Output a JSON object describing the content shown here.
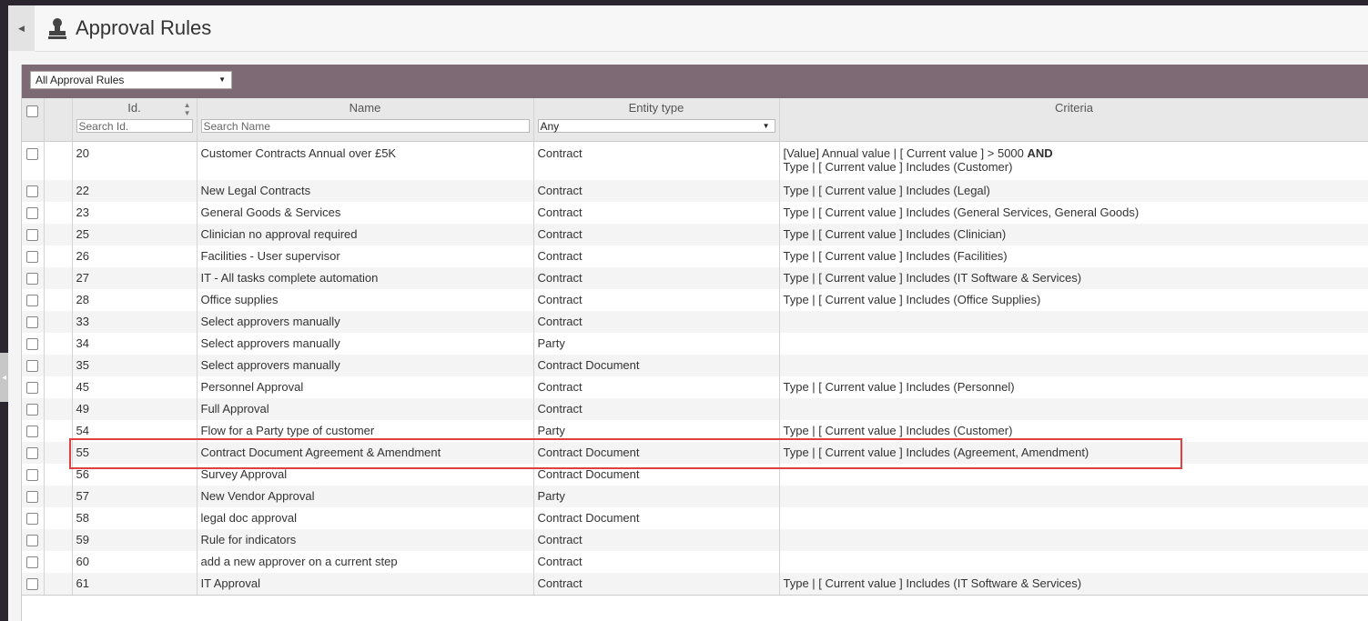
{
  "header": {
    "title": "Approval Rules"
  },
  "toolbar": {
    "filter_selected": "All Approval Rules"
  },
  "table": {
    "columns": {
      "id": "Id.",
      "name": "Name",
      "entity": "Entity type",
      "criteria": "Criteria"
    },
    "filters": {
      "id_placeholder": "Search Id.",
      "name_placeholder": "Search Name",
      "entity_selected": "Any"
    },
    "rows": [
      {
        "id": "20",
        "name": "Customer Contracts Annual over £5K",
        "entity": "Contract",
        "criteria_line1": "[Value] Annual value | [ Current value ] > 5000",
        "criteria_and": "AND",
        "criteria_line2": "Type | [ Current value ] Includes (Customer)"
      },
      {
        "id": "22",
        "name": "New Legal Contracts",
        "entity": "Contract",
        "criteria": "Type | [ Current value ] Includes (Legal)"
      },
      {
        "id": "23",
        "name": "General Goods & Services",
        "entity": "Contract",
        "criteria": "Type | [ Current value ] Includes (General Services, General Goods)"
      },
      {
        "id": "25",
        "name": "Clinician no approval required",
        "entity": "Contract",
        "criteria": "Type | [ Current value ] Includes (Clinician)"
      },
      {
        "id": "26",
        "name": "Facilities - User supervisor",
        "entity": "Contract",
        "criteria": "Type | [ Current value ] Includes (Facilities)"
      },
      {
        "id": "27",
        "name": "IT - All tasks complete automation",
        "entity": "Contract",
        "criteria": "Type | [ Current value ] Includes (IT Software & Services)"
      },
      {
        "id": "28",
        "name": "Office supplies",
        "entity": "Contract",
        "criteria": "Type | [ Current value ] Includes (Office Supplies)"
      },
      {
        "id": "33",
        "name": "Select approvers manually",
        "entity": "Contract",
        "criteria": ""
      },
      {
        "id": "34",
        "name": "Select approvers manually",
        "entity": "Party",
        "criteria": ""
      },
      {
        "id": "35",
        "name": "Select approvers manually",
        "entity": "Contract Document",
        "criteria": ""
      },
      {
        "id": "45",
        "name": "Personnel Approval",
        "entity": "Contract",
        "criteria": "Type | [ Current value ] Includes (Personnel)"
      },
      {
        "id": "49",
        "name": "Full Approval",
        "entity": "Contract",
        "criteria": ""
      },
      {
        "id": "54",
        "name": "Flow for a Party type of customer",
        "entity": "Party",
        "criteria": "Type | [ Current value ] Includes (Customer)"
      },
      {
        "id": "55",
        "name": "Contract Document Agreement & Amendment",
        "entity": "Contract Document",
        "criteria": "Type | [ Current value ] Includes (Agreement, Amendment)"
      },
      {
        "id": "56",
        "name": "Survey Approval",
        "entity": "Contract Document",
        "criteria": ""
      },
      {
        "id": "57",
        "name": "New Vendor Approval",
        "entity": "Party",
        "criteria": ""
      },
      {
        "id": "58",
        "name": "legal doc approval",
        "entity": "Contract Document",
        "criteria": ""
      },
      {
        "id": "59",
        "name": "Rule for indicators",
        "entity": "Contract",
        "criteria": ""
      },
      {
        "id": "60",
        "name": "add a new approver on a current step",
        "entity": "Contract",
        "criteria": ""
      },
      {
        "id": "61",
        "name": "IT Approval",
        "entity": "Contract",
        "criteria": "Type | [ Current value ] Includes (IT Software & Services)"
      }
    ]
  },
  "colors": {
    "toolbar": "#7e6a75",
    "highlight": "#e0403f"
  }
}
